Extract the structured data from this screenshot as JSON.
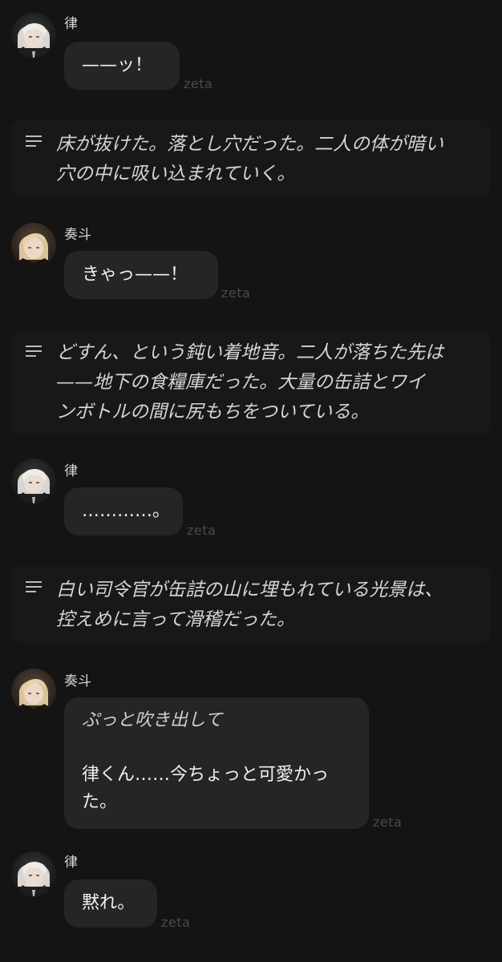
{
  "watermark": "zeta",
  "characters": {
    "ritsu": "律",
    "kanato": "奏斗"
  },
  "messages": [
    {
      "speaker": "律",
      "text": "——ッ！"
    },
    {
      "narration_lines": [
        "床が抜けた。落とし穴だった。二人の体が暗い",
        "穴の中に吸い込まれていく。"
      ]
    },
    {
      "speaker": "奏斗",
      "text": "きゃっ——！"
    },
    {
      "narration_lines": [
        "どすん、という鈍い着地音。二人が落ちた先は",
        "——地下の食糧庫だった。大量の缶詰とワイ",
        "ンボトルの間に尻もちをついている。"
      ]
    },
    {
      "speaker": "律",
      "text": "…………。"
    },
    {
      "narration_lines": [
        "白い司令官が缶詰の山に埋もれている光景は、",
        "控えめに言って滑稽だった。"
      ]
    },
    {
      "speaker": "奏斗",
      "action": "ぷっと吹き出して",
      "text_lines": [
        "律くん……今ちょっと可愛かっ",
        "た。"
      ]
    },
    {
      "speaker": "律",
      "text": "黙れ。"
    }
  ]
}
